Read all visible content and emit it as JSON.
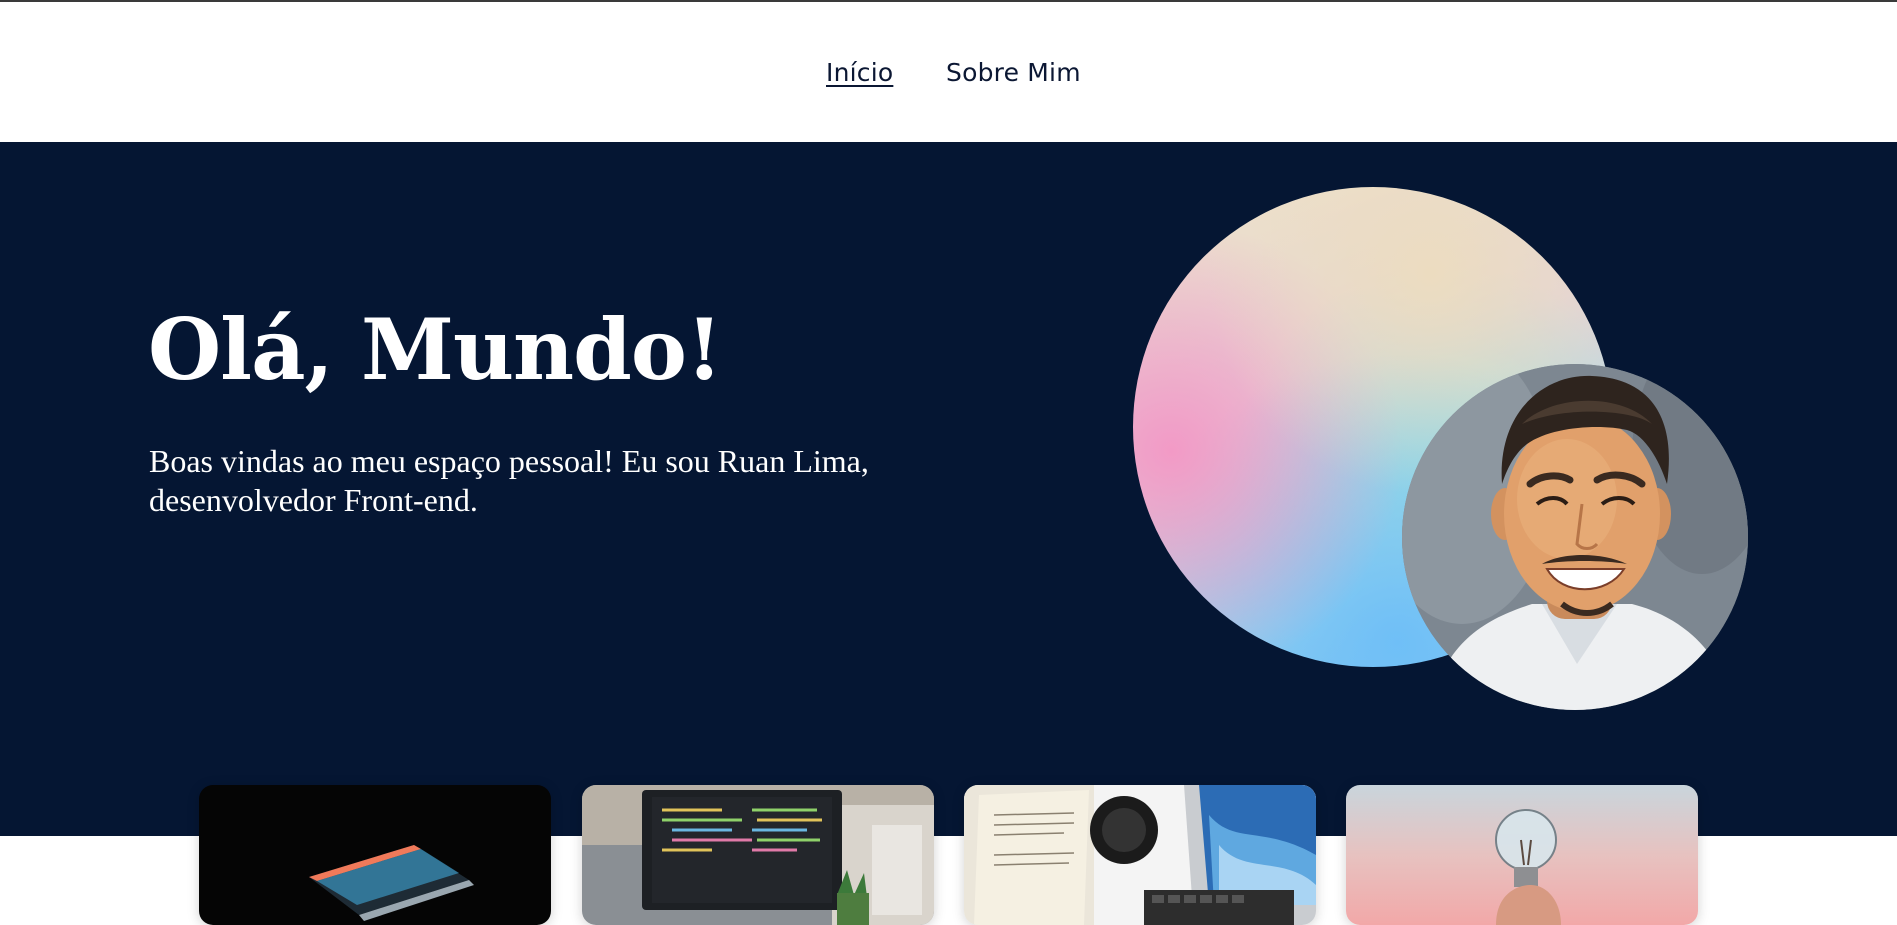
{
  "nav": {
    "items": [
      {
        "label": "Início",
        "active": true
      },
      {
        "label": "Sobre Mim",
        "active": false
      }
    ]
  },
  "hero": {
    "title": "Olá, Mundo!",
    "subtitle": "Boas vindas ao meu espaço pessoal! Eu sou Ruan Lima, desenvolvedor Front-end."
  },
  "colors": {
    "hero_background": "#051633",
    "nav_text": "#0b1733",
    "page_background": "#ffffff"
  },
  "cards": [
    {
      "image": "laptop-dark-image"
    },
    {
      "image": "code-laptop-image"
    },
    {
      "image": "desk-book-laptop-image"
    },
    {
      "image": "lightbulb-hand-image"
    }
  ]
}
